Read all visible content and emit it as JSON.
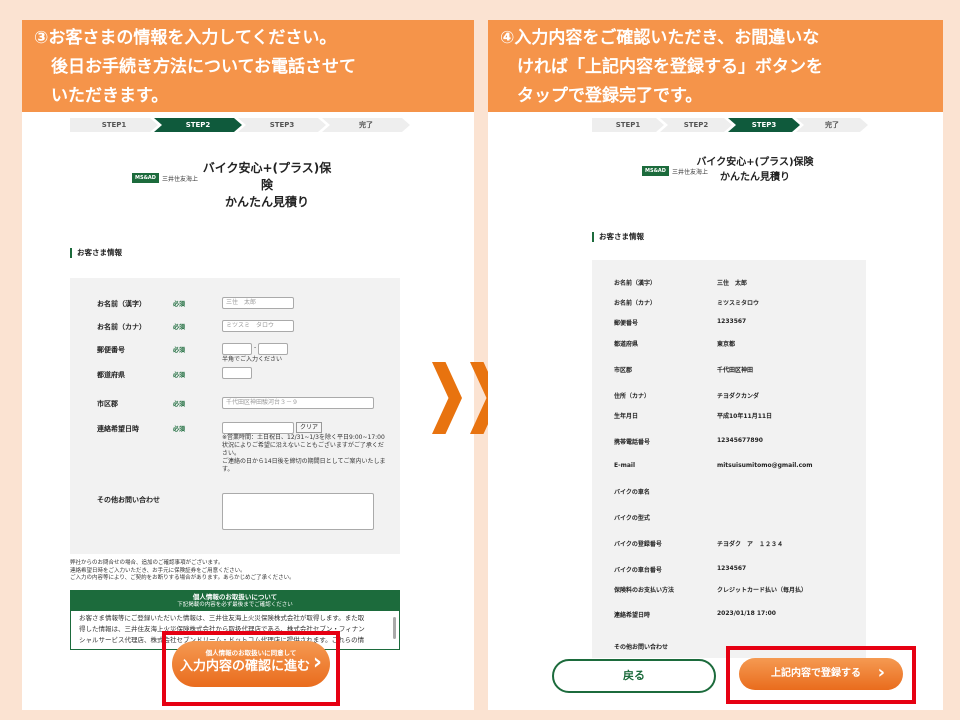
{
  "left": {
    "header": [
      "③お客さまの情報を入力してください。",
      "　後日お手続き方法についてお電話させて",
      "　いただきます。"
    ],
    "steps": [
      "STEP1",
      "STEP2",
      "STEP3",
      "完了"
    ],
    "active_step": 2,
    "brand": {
      "logo": "MS&AD",
      "name": "三井住友海上"
    },
    "product": {
      "line1": "バイク安心+(プラス)保険",
      "line2": "かんたん見積り"
    },
    "section": "お客さま情報",
    "required": "必須",
    "fields": {
      "kanji": {
        "label": "お名前（漢字）",
        "placeholder": "三住　太郎"
      },
      "kana": {
        "label": "お名前（カナ）",
        "placeholder": "ミツスミ　タロウ"
      },
      "postal": {
        "label": "郵便番号",
        "separator": "-",
        "note": "半角でご入力ください"
      },
      "pref": {
        "label": "都道府県"
      },
      "city": {
        "label": "市区郡",
        "placeholder": "千代田区神田駿河台３－９"
      },
      "contact": {
        "label": "連絡希望日時",
        "clear": "クリア",
        "note1": "※営業時間：土日祝日、12/31~1/3を除く平日9:00~17:00",
        "note2": "状況によりご希望に沿えないこともございますがご了承くだ",
        "note3": "さい。",
        "note4": "ご連絡の日から14日後を締切の期間日としてご案内いたしま",
        "note5": "す。"
      },
      "other": {
        "label": "その他お問い合わせ"
      }
    },
    "notes": [
      "弊社からのお問合せの場合、追加のご確認事項がございます。",
      "連絡希望日時をご入力いただき、お手元に保険証券をご用意ください。",
      "ご入力の内容等により、ご契約をお断りする場合があります。あらかじめご了承ください。"
    ],
    "privacy": {
      "title": "個人情報のお取扱いについて",
      "subtitle": "下記掲載の内容を必ず最後までご確認ください",
      "body1": "お客さま情報等にご登録いただいた情報は、三井住友海上火災保険株式会社が取得します。また取",
      "body2": "得した情報は、三井住友海上火災保険株式会社から取扱代理店である、株式会社セブン・フィナン",
      "body3": "シャルサービス代理店、株式会社セブンドリーム・ドットコム代理店に提供されます。これらの情"
    },
    "button": {
      "top": "個人情報のお取扱いに同意して",
      "main": "入力内容の確認に進む",
      "arrow": "›"
    }
  },
  "right": {
    "header": [
      "④入力内容をご確認いただき、お間違いな",
      "　ければ「上記内容を登録する」ボタンを",
      "　タップで登録完了です。"
    ],
    "steps": [
      "STEP1",
      "STEP2",
      "STEP3",
      "完了"
    ],
    "active_step": 3,
    "brand": {
      "logo": "MS&AD",
      "name": "三井住友海上"
    },
    "product": {
      "line1": "バイク安心+(プラス)保険",
      "line2": "かんたん見積り"
    },
    "section": "お客さま情報",
    "rows": [
      {
        "label": "お名前（漢字）",
        "value": "三住　太郎"
      },
      {
        "label": "お名前（カナ）",
        "value": "ミツスミタロウ"
      },
      {
        "label": "郵便番号",
        "value": "1233567"
      },
      {
        "label": "都道府県",
        "value": "東京都"
      },
      {
        "label": "市区郡",
        "value": "千代田区神田"
      },
      {
        "label": "住所（カナ）",
        "value": "チヨダクカンダ"
      },
      {
        "label": "生年月日",
        "value": "平成10年11月11日"
      },
      {
        "label": "携帯電話番号",
        "value": "12345677890"
      },
      {
        "label": "E-mail",
        "value": "mitsuisumitomo@gmail.com"
      },
      {
        "label": "バイクの車名",
        "value": ""
      },
      {
        "label": "バイクの型式",
        "value": ""
      },
      {
        "label": "バイクの登録番号",
        "value": "チヨダク　ア　１２３４"
      },
      {
        "label": "バイクの車台番号",
        "value": "1234567"
      },
      {
        "label": "保険料のお支払い方法",
        "value": "クレジットカード払い（毎月払）"
      },
      {
        "label": "連絡希望日時",
        "value": "2023/01/18 17:00"
      },
      {
        "label": "その他お問い合わせ",
        "value": ""
      }
    ],
    "back": "戻る",
    "submit": "上記内容で登録する",
    "arrow": "›"
  },
  "colors": {
    "orange": "#f5944a",
    "green": "#1c6b3c",
    "red": "#e60012",
    "chevron": "#e8730f",
    "background": "#fbe3d2"
  }
}
